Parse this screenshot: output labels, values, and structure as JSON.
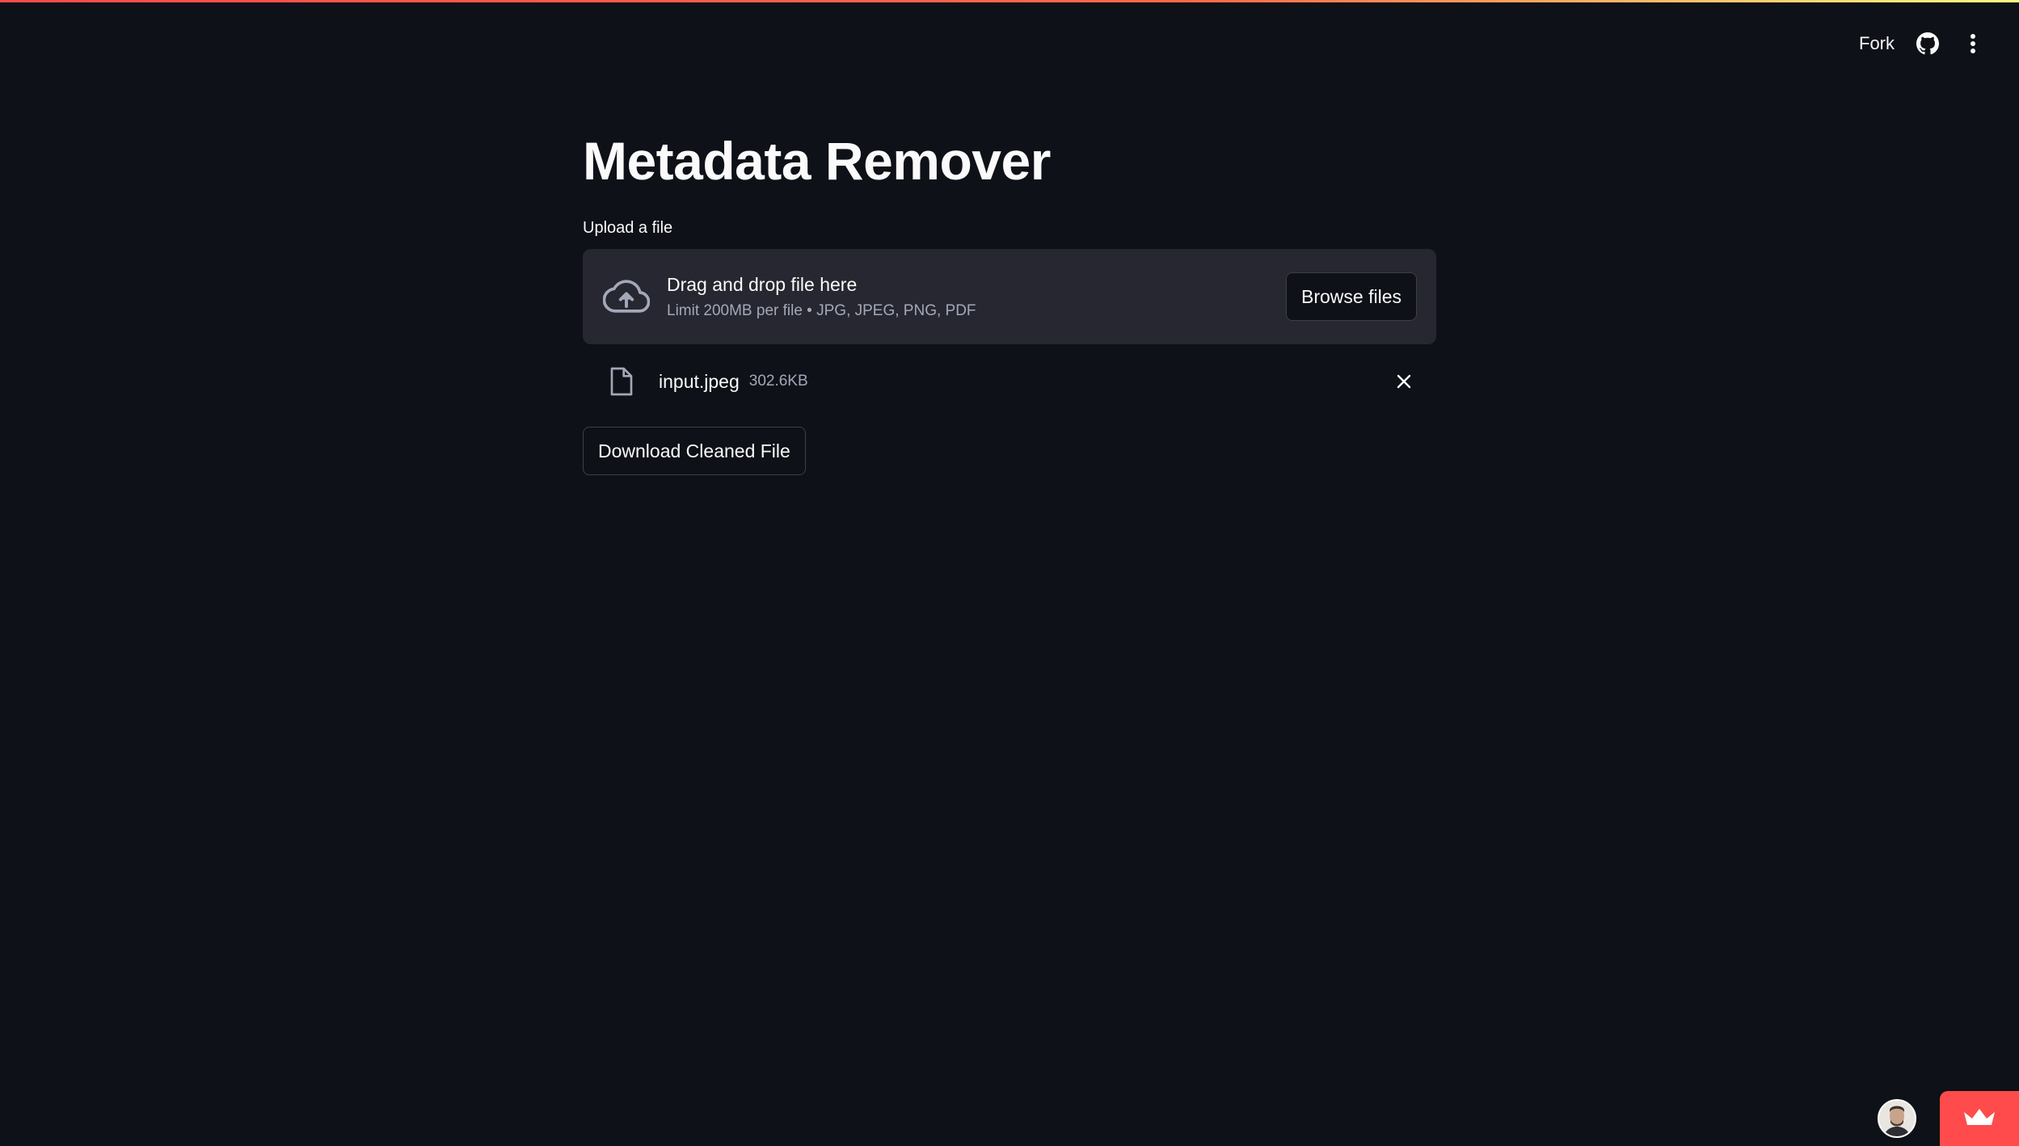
{
  "header": {
    "fork_label": "Fork",
    "github_icon": "github-icon",
    "menu_icon": "more-vert-icon"
  },
  "main": {
    "title": "Metadata Remover",
    "uploader": {
      "label": "Upload a file",
      "dropzone_title": "Drag and drop file here",
      "dropzone_limit": "Limit 200MB per file • JPG, JPEG, PNG, PDF",
      "browse_label": "Browse files",
      "icon": "cloud-upload-icon"
    },
    "uploaded_file": {
      "name": "input.jpeg",
      "size": "302.6KB",
      "icon": "file-icon",
      "remove_icon": "close-icon"
    },
    "download_label": "Download Cleaned File"
  },
  "footer": {
    "avatar_icon": "avatar",
    "badge_icon": "crown-icon",
    "badge_color": "#ff4b4b"
  },
  "colors": {
    "background": "#0e1117",
    "surface": "#262730",
    "text": "#fafafa",
    "muted_text": "#a3a8b8",
    "accent": "#ff4b4b"
  }
}
